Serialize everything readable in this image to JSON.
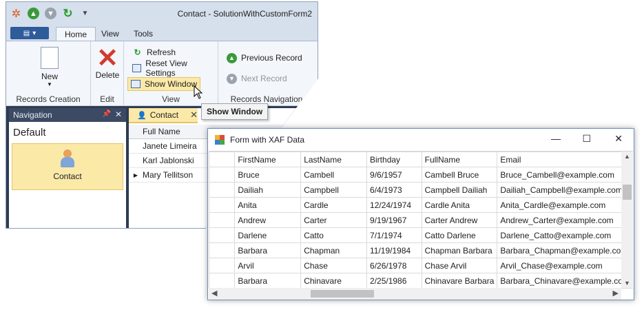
{
  "app": {
    "title": "Contact - SolutionWithCustomForm2",
    "tabs": [
      "Home",
      "View",
      "Tools"
    ],
    "ribbon": {
      "records_creation": {
        "caption": "Records Creation",
        "new_label": "New"
      },
      "edit": {
        "caption": "Edit",
        "delete_label": "Delete"
      },
      "view": {
        "caption": "View",
        "refresh": "Refresh",
        "reset": "Reset View Settings",
        "show_window": "Show Window"
      },
      "records_navigation": {
        "caption": "Records Navigation",
        "previous": "Previous Record",
        "next": "Next Record"
      }
    },
    "tooltip": "Show Window",
    "navigation": {
      "header": "Navigation",
      "group": "Default",
      "item": "Contact"
    },
    "document_tab": "Contact",
    "grid": {
      "column": "Full Name",
      "rows": [
        "Janete Limeira",
        "Karl Jablonski",
        "Mary Tellitson"
      ]
    }
  },
  "form": {
    "title": "Form with XAF Data",
    "columns": [
      "FirstName",
      "LastName",
      "Birthday",
      "FullName",
      "Email"
    ],
    "rows": [
      [
        "Bruce",
        "Cambell",
        "9/6/1957",
        "Cambell Bruce",
        "Bruce_Cambell@example.com"
      ],
      [
        "Dailiah",
        "Campbell",
        "6/4/1973",
        "Campbell Dailiah",
        "Dailiah_Campbell@example.com"
      ],
      [
        "Anita",
        "Cardle",
        "12/24/1974",
        "Cardle Anita",
        "Anita_Cardle@example.com"
      ],
      [
        "Andrew",
        "Carter",
        "9/19/1967",
        "Carter Andrew",
        "Andrew_Carter@example.com"
      ],
      [
        "Darlene",
        "Catto",
        "7/1/1974",
        "Catto Darlene",
        "Darlene_Catto@example.com"
      ],
      [
        "Barbara",
        "Chapman",
        "11/19/1984",
        "Chapman Barbara",
        "Barbara_Chapman@example.com"
      ],
      [
        "Arvil",
        "Chase",
        "6/26/1978",
        "Chase Arvil",
        "Arvil_Chase@example.com"
      ],
      [
        "Barbara",
        "Chinavare",
        "2/25/1986",
        "Chinavare Barbara",
        "Barbara_Chinavare@example.com"
      ]
    ]
  }
}
